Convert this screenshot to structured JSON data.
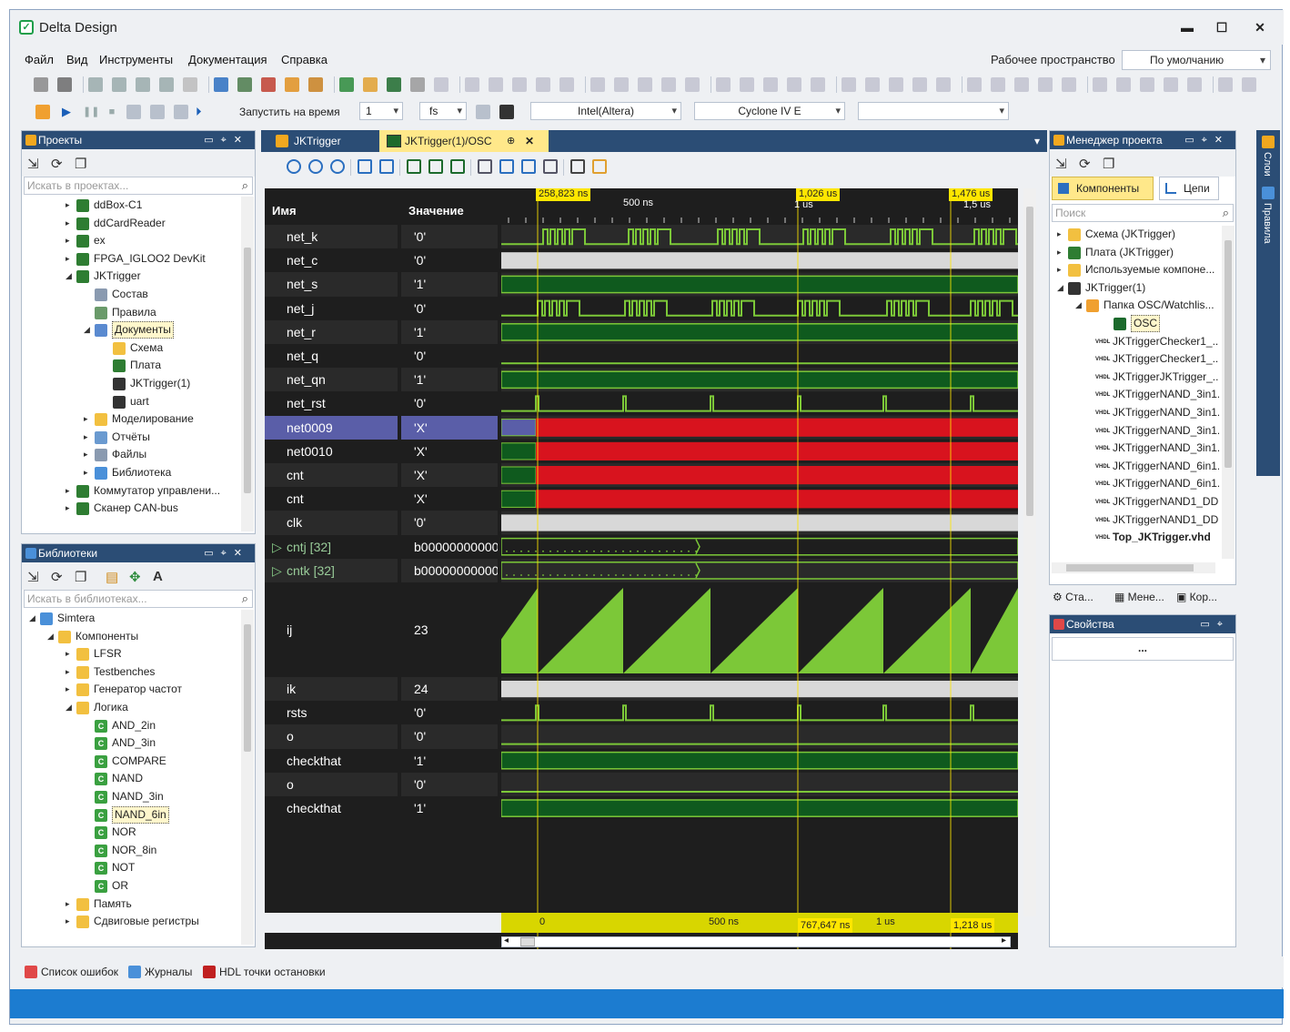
{
  "window": {
    "title": "Delta Design",
    "minimize": "▬",
    "maximize": "☐",
    "close": "✕"
  },
  "menu": [
    "Файл",
    "Вид",
    "Инструменты",
    "Документация",
    "Справка"
  ],
  "workspace": {
    "label": "Рабочее пространство",
    "value": "По умолчанию"
  },
  "toolbar2": {
    "run_label": "Запустить на время",
    "run_value": "1",
    "unit": "fs",
    "vendor": "Intel(Altera)",
    "device": "Cyclone IV E",
    "extra": ""
  },
  "projects": {
    "title": "Проекты",
    "search_placeholder": "Искать в проектах...",
    "items": [
      "ddBox-C1",
      "ddCardReader",
      "ex",
      "FPGA_IGLOO2 DevKit",
      "JKTrigger",
      "Состав",
      "Правила",
      "Документы",
      "Схема",
      "Плата",
      "JKTrigger(1)",
      "uart",
      "Моделирование",
      "Отчёты",
      "Файлы",
      "Библиотека",
      "Коммутатор управлени...",
      "Сканер CAN-bus"
    ]
  },
  "libraries": {
    "title": "Библиотеки",
    "search_placeholder": "Искать в библиотеках...",
    "items": [
      "Simtera",
      "Компоненты",
      "LFSR",
      "Testbenches",
      "Генератор частот",
      "Логика",
      "AND_2in",
      "AND_3in",
      "COMPARE",
      "NAND",
      "NAND_3in",
      "NAND_6in",
      "NOR",
      "NOR_8in",
      "NOT",
      "OR",
      "Память",
      "Сдвиговые регистры"
    ]
  },
  "doc_tabs": [
    {
      "label": "JKTrigger"
    },
    {
      "label": "JKTrigger(1)/OSC",
      "pin": "⊕",
      "close": "✕"
    }
  ],
  "osc": {
    "col_name": "Имя",
    "col_value": "Значение",
    "cursors_top": [
      "258,823 ns",
      "1,026 us",
      "1,476 us"
    ],
    "cursors_bottom": [
      "767,647 ns",
      "1,218 us"
    ],
    "ruler_top": [
      "500 ns",
      "1 us",
      "1,5 us"
    ],
    "ruler_bottom": [
      "0",
      "500 ns",
      "1 us"
    ],
    "signals": [
      {
        "name": "net_k",
        "value": "'0'"
      },
      {
        "name": "net_c",
        "value": "'0'"
      },
      {
        "name": "net_s",
        "value": "'1'"
      },
      {
        "name": "net_j",
        "value": "'0'"
      },
      {
        "name": "net_r",
        "value": "'1'"
      },
      {
        "name": "net_q",
        "value": "'0'"
      },
      {
        "name": "net_qn",
        "value": "'1'"
      },
      {
        "name": "net_rst",
        "value": "'0'"
      },
      {
        "name": "net0009",
        "value": "'X'"
      },
      {
        "name": "net0010",
        "value": "'X'"
      },
      {
        "name": "cnt",
        "value": "'X'"
      },
      {
        "name": "cnt",
        "value": "'X'"
      },
      {
        "name": "clk",
        "value": "'0'"
      },
      {
        "name": "cntj [32]",
        "value": "b00000000000"
      },
      {
        "name": "cntk [32]",
        "value": "b00000000000"
      },
      {
        "name": "ij",
        "value": "23"
      },
      {
        "name": "ik",
        "value": "24"
      },
      {
        "name": "rsts",
        "value": "'0'"
      },
      {
        "name": "o",
        "value": "'0'"
      },
      {
        "name": "checkthat",
        "value": "'1'"
      },
      {
        "name": "o",
        "value": "'0'"
      },
      {
        "name": "checkthat",
        "value": "'1'"
      }
    ]
  },
  "project_manager": {
    "title": "Менеджер проекта",
    "tab_components": "Компоненты",
    "tab_nets": "Цепи",
    "search_placeholder": "Поиск",
    "items": [
      "Схема (JKTrigger)",
      "Плата (JKTrigger)",
      "Используемые компоне...",
      "JKTrigger(1)",
      "Папка OSC/Watchlis...",
      "OSC",
      "JKTriggerChecker1_...",
      "JKTriggerChecker1_...",
      "JKTriggerJKTrigger_...",
      "JKTriggerNAND_3in1...",
      "JKTriggerNAND_3in1...",
      "JKTriggerNAND_3in1...",
      "JKTriggerNAND_3in1...",
      "JKTriggerNAND_6in1...",
      "JKTriggerNAND_6in1...",
      "JKTriggerNAND1_DD...",
      "JKTriggerNAND1_DD...",
      "Top_JKTrigger.vhd"
    ],
    "bottom_tabs": [
      "Ста...",
      "Мене...",
      "Кор..."
    ]
  },
  "properties": {
    "title": "Свойства",
    "value": "..."
  },
  "right_strip": [
    "Слои",
    "Правила"
  ],
  "bottom_tabs": [
    "Список ошибок",
    "Журналы",
    "HDL точки остановки"
  ],
  "colors": {
    "header": "#2b4d75",
    "status": "#1c7cd0",
    "wave_green": "#7cc838",
    "wave_red": "#d8131e",
    "cursor": "#ffe600"
  }
}
